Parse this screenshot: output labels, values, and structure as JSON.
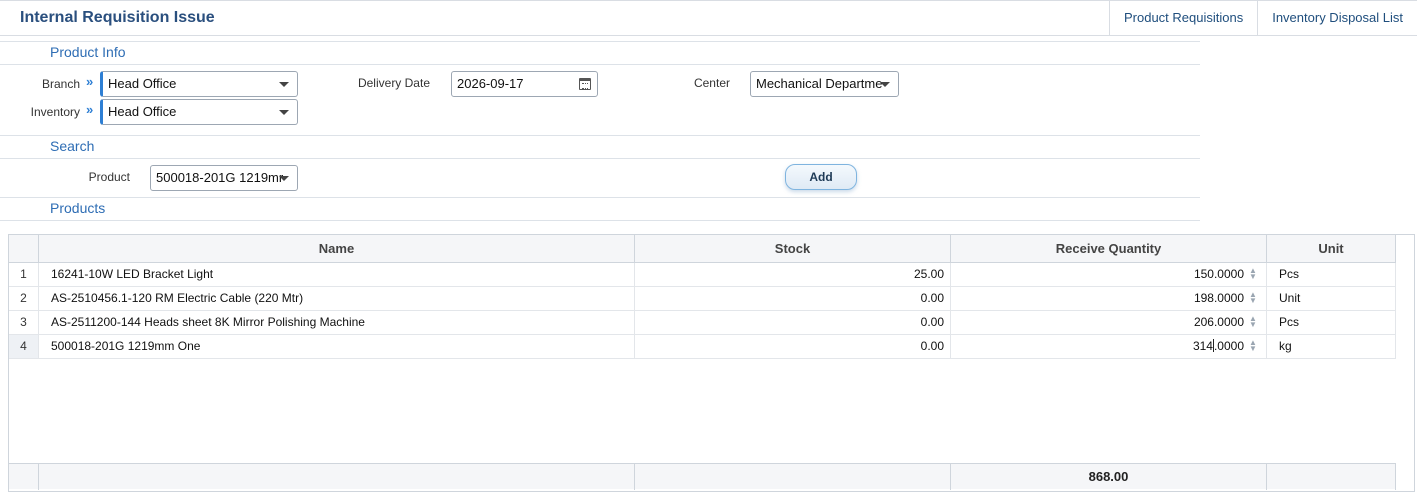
{
  "app": {
    "title": "Internal Requisition Issue"
  },
  "header_links": [
    "Product Requisitions",
    "Inventory Disposal List"
  ],
  "product_info": {
    "section_title": "Product Info",
    "branch_label": "Branch",
    "branch_value": "Head Office",
    "inventory_label": "Inventory",
    "inventory_value": "Head Office",
    "delivery_date_label": "Delivery Date",
    "delivery_date_value": "2026-09-17",
    "center_label": "Center",
    "center_value": "Mechanical Departme"
  },
  "search": {
    "section_title": "Search",
    "product_label": "Product",
    "product_value": "500018-201G 1219mr",
    "add_label": "Add"
  },
  "products": {
    "section_title": "Products",
    "columns": [
      "Name",
      "Stock",
      "Receive Quantity",
      "Unit"
    ],
    "rows": [
      {
        "n": "1",
        "name": "16241-10W LED Bracket Light",
        "stock": "25.00",
        "qty": "150.0000",
        "unit": "Pcs"
      },
      {
        "n": "2",
        "name": "AS-2510456.1-120 RM Electric Cable (220 Mtr)",
        "stock": "0.00",
        "qty": "198.0000",
        "unit": "Unit"
      },
      {
        "n": "3",
        "name": "AS-2511200-144 Heads sheet 8K Mirror Polishing Machine",
        "stock": "0.00",
        "qty": "206.0000",
        "unit": "Pcs"
      },
      {
        "n": "4",
        "name": "500018-201G 1219mm One",
        "stock": "0.00",
        "qty_before": "314",
        "qty_after": ".0000",
        "unit": "kg"
      }
    ],
    "total_qty": "868.00"
  },
  "colors": {
    "accent": "#2e7fd4",
    "title": "#2a4f7e",
    "section": "#2e6db4"
  }
}
